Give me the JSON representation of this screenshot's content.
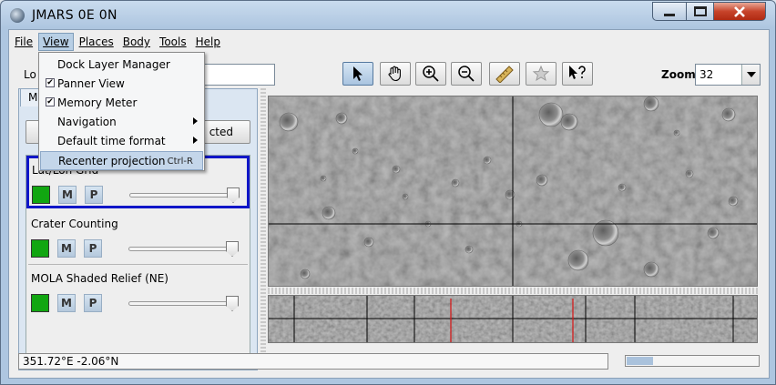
{
  "window": {
    "title": "JMARS 0E 0N"
  },
  "menubar": [
    {
      "label": "File"
    },
    {
      "label": "View"
    },
    {
      "label": "Places"
    },
    {
      "label": "Body"
    },
    {
      "label": "Tools"
    },
    {
      "label": "Help"
    }
  ],
  "view_menu": {
    "items": [
      {
        "label": "Dock Layer Manager",
        "checkbox": false
      },
      {
        "label": "Panner View",
        "checkbox": true,
        "checked": true
      },
      {
        "label": "Memory Meter",
        "checkbox": true,
        "checked": true
      },
      {
        "label": "Navigation",
        "submenu": true
      },
      {
        "label": "Default time format",
        "submenu": true
      },
      {
        "label": "Recenter projection",
        "accelerator": "Ctrl-R",
        "highlighted": true
      }
    ]
  },
  "toolbar": {
    "location_label": "Lo",
    "tools": [
      {
        "icon": "select-arrow-icon"
      },
      {
        "icon": "pan-hand-icon"
      },
      {
        "icon": "zoom-in-icon"
      },
      {
        "icon": "zoom-out-icon"
      },
      {
        "icon": "ruler-icon"
      },
      {
        "icon": "star-icon"
      },
      {
        "icon": "whats-this-icon"
      }
    ],
    "zoom_label": "Zoom:",
    "zoom_value": "32"
  },
  "layer_panel": {
    "tab_label": "M",
    "button_label": "cted",
    "layers": [
      {
        "name": "Lat/Lon Grid",
        "color": "#11a611",
        "m": "M",
        "p": "P",
        "selected": true
      },
      {
        "name": "Crater Counting",
        "color": "#11a611",
        "m": "M",
        "p": "P",
        "selected": false
      },
      {
        "name": "MOLA Shaded Relief (NE)",
        "color": "#11a611",
        "m": "M",
        "p": "P",
        "selected": false
      }
    ]
  },
  "status": {
    "coords": "351.72°E  -2.06°N",
    "memory_fraction": 0.2
  }
}
